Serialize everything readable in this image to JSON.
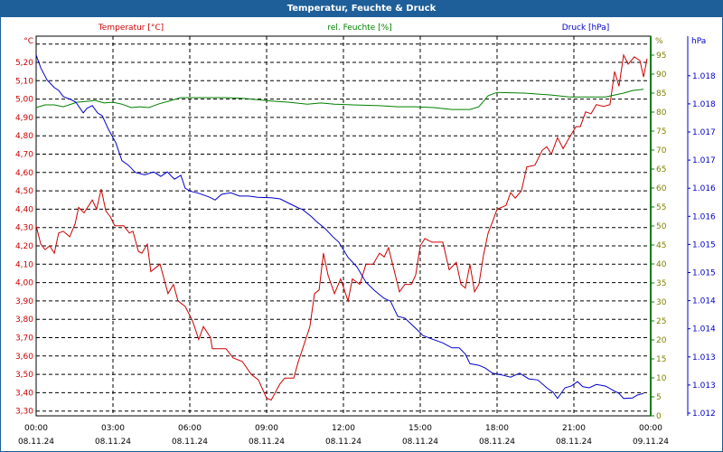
{
  "window": {
    "title": "Temperatur, Feuchte & Druck"
  },
  "colors": {
    "temperature": "#cc0000",
    "humidity": "#008000",
    "pressure": "#0000cc",
    "titlebar": "#1f5f99",
    "tick_text_humidity": "#808000"
  },
  "chart_data": {
    "type": "line",
    "title": "Temperatur, Feuchte & Druck",
    "x_unit": "hours since 08.11.24 00:00",
    "xlim": [
      0,
      24
    ],
    "x_ticks": [
      {
        "time": "00:00",
        "date": "08.11.24"
      },
      {
        "time": "03:00",
        "date": "08.11.24"
      },
      {
        "time": "06:00",
        "date": "08.11.24"
      },
      {
        "time": "09:00",
        "date": "08.11.24"
      },
      {
        "time": "12:00",
        "date": "08.11.24"
      },
      {
        "time": "15:00",
        "date": "08.11.24"
      },
      {
        "time": "18:00",
        "date": "08.11.24"
      },
      {
        "time": "21:00",
        "date": "08.11.24"
      },
      {
        "time": "00:00",
        "date": "09.11.24"
      }
    ],
    "grid": true,
    "axes": {
      "temperature": {
        "label": "Temperatur [°C]",
        "unit": "°C",
        "ylim": [
          3.274,
          5.343
        ],
        "ticks": [
          "5,20",
          "5,10",
          "5,00",
          "4,90",
          "4,80",
          "4,70",
          "4,60",
          "4,50",
          "4,40",
          "4,30",
          "4,20",
          "4,10",
          "4,00",
          "3,90",
          "3,80",
          "3,70",
          "3,60",
          "3,50",
          "3,40",
          "3,30"
        ]
      },
      "humidity": {
        "label": "rel. Feuchte [%]",
        "unit": "%",
        "ylim": [
          0,
          100
        ],
        "ticks": [
          "95",
          "90",
          "85",
          "80",
          "75",
          "70",
          "65",
          "60",
          "55",
          "50",
          "45",
          "40",
          "35",
          "30",
          "25",
          "20",
          "15",
          "10",
          "5",
          "0"
        ]
      },
      "pressure": {
        "label": "Druck [hPa]",
        "unit": "hPa",
        "ylim": [
          1.012,
          1.018
        ],
        "ticks": [
          "1.018",
          "1.018",
          "1.017",
          "1.017",
          "1.016",
          "1.016",
          "1.015",
          "1.015",
          "1.014",
          "1.014",
          "1.013",
          "1.013",
          "1.012"
        ]
      }
    },
    "series": [
      {
        "name": "Temperatur [°C]",
        "axis": "temperature",
        "points": [
          [
            0,
            4.31
          ],
          [
            0.18,
            4.21
          ],
          [
            0.35,
            4.18
          ],
          [
            0.53,
            4.2
          ],
          [
            0.71,
            4.16
          ],
          [
            0.88,
            4.27
          ],
          [
            1.06,
            4.28
          ],
          [
            1.31,
            4.25
          ],
          [
            1.52,
            4.32
          ],
          [
            1.66,
            4.41
          ],
          [
            1.87,
            4.38
          ],
          [
            2.19,
            4.45
          ],
          [
            2.36,
            4.4
          ],
          [
            2.54,
            4.51
          ],
          [
            2.72,
            4.39
          ],
          [
            2.89,
            4.36
          ],
          [
            3.07,
            4.31
          ],
          [
            3.42,
            4.31
          ],
          [
            3.64,
            4.27
          ],
          [
            3.78,
            4.28
          ],
          [
            3.99,
            4.17
          ],
          [
            4.13,
            4.16
          ],
          [
            4.34,
            4.21
          ],
          [
            4.48,
            4.06
          ],
          [
            4.84,
            4.1
          ],
          [
            5.15,
            3.94
          ],
          [
            5.36,
            3.99
          ],
          [
            5.54,
            3.9
          ],
          [
            5.82,
            3.87
          ],
          [
            6.11,
            3.79
          ],
          [
            6.35,
            3.69
          ],
          [
            6.53,
            3.76
          ],
          [
            6.81,
            3.7
          ],
          [
            6.88,
            3.64
          ],
          [
            7.41,
            3.64
          ],
          [
            7.69,
            3.59
          ],
          [
            8.05,
            3.57
          ],
          [
            8.4,
            3.5
          ],
          [
            8.68,
            3.47
          ],
          [
            9.0,
            3.37
          ],
          [
            9.18,
            3.36
          ],
          [
            9.53,
            3.45
          ],
          [
            9.71,
            3.48
          ],
          [
            10.06,
            3.48
          ],
          [
            10.24,
            3.57
          ],
          [
            10.41,
            3.64
          ],
          [
            10.69,
            3.76
          ],
          [
            10.87,
            3.94
          ],
          [
            11.05,
            3.96
          ],
          [
            11.22,
            4.16
          ],
          [
            11.4,
            4.04
          ],
          [
            11.65,
            3.94
          ],
          [
            11.89,
            4.02
          ],
          [
            12.18,
            3.9
          ],
          [
            12.35,
            4.02
          ],
          [
            12.64,
            3.99
          ],
          [
            12.88,
            4.1
          ],
          [
            13.16,
            4.1
          ],
          [
            13.41,
            4.16
          ],
          [
            13.59,
            4.14
          ],
          [
            13.76,
            4.19
          ],
          [
            14.19,
            3.95
          ],
          [
            14.4,
            3.99
          ],
          [
            14.65,
            3.99
          ],
          [
            14.82,
            4.04
          ],
          [
            15.0,
            4.2
          ],
          [
            15.18,
            4.24
          ],
          [
            15.46,
            4.22
          ],
          [
            15.64,
            4.22
          ],
          [
            15.88,
            4.22
          ],
          [
            16.13,
            4.07
          ],
          [
            16.41,
            4.11
          ],
          [
            16.59,
            3.99
          ],
          [
            16.76,
            3.97
          ],
          [
            16.94,
            4.1
          ],
          [
            17.12,
            3.95
          ],
          [
            17.29,
            3.99
          ],
          [
            17.47,
            4.15
          ],
          [
            17.65,
            4.27
          ],
          [
            17.82,
            4.33
          ],
          [
            18.0,
            4.4
          ],
          [
            18.35,
            4.42
          ],
          [
            18.53,
            4.49
          ],
          [
            18.71,
            4.46
          ],
          [
            18.95,
            4.5
          ],
          [
            19.16,
            4.63
          ],
          [
            19.48,
            4.64
          ],
          [
            19.76,
            4.72
          ],
          [
            19.94,
            4.74
          ],
          [
            20.12,
            4.7
          ],
          [
            20.36,
            4.79
          ],
          [
            20.58,
            4.73
          ],
          [
            20.82,
            4.79
          ],
          [
            21.08,
            4.85
          ],
          [
            21.25,
            4.85
          ],
          [
            21.46,
            4.93
          ],
          [
            21.67,
            4.92
          ],
          [
            21.88,
            4.97
          ],
          [
            22.16,
            4.96
          ],
          [
            22.41,
            4.97
          ],
          [
            22.59,
            5.15
          ],
          [
            22.76,
            5.07
          ],
          [
            22.94,
            5.24
          ],
          [
            23.12,
            5.19
          ],
          [
            23.36,
            5.23
          ],
          [
            23.58,
            5.21
          ],
          [
            23.72,
            5.12
          ],
          [
            23.86,
            5.22
          ]
        ]
      },
      {
        "name": "rel. Feuchte [%]",
        "axis": "humidity",
        "points": [
          [
            0,
            81.2
          ],
          [
            0.35,
            81.9
          ],
          [
            0.71,
            81.9
          ],
          [
            1.06,
            81.4
          ],
          [
            1.59,
            82.6
          ],
          [
            2.12,
            82.9
          ],
          [
            2.29,
            83.1
          ],
          [
            2.65,
            82.4
          ],
          [
            3.0,
            82.6
          ],
          [
            3.35,
            82.1
          ],
          [
            3.71,
            81.2
          ],
          [
            4.06,
            81.4
          ],
          [
            4.41,
            81.2
          ],
          [
            4.76,
            82.1
          ],
          [
            5.29,
            83.1
          ],
          [
            5.65,
            83.8
          ],
          [
            6.35,
            83.8
          ],
          [
            7.41,
            83.8
          ],
          [
            8.12,
            83.6
          ],
          [
            9.18,
            82.9
          ],
          [
            9.88,
            82.6
          ],
          [
            10.59,
            82.1
          ],
          [
            11.12,
            82.4
          ],
          [
            11.65,
            82.1
          ],
          [
            12.35,
            81.9
          ],
          [
            13.41,
            81.7
          ],
          [
            14.12,
            81.4
          ],
          [
            14.82,
            81.4
          ],
          [
            15.53,
            81.2
          ],
          [
            16.24,
            80.7
          ],
          [
            16.94,
            80.7
          ],
          [
            17.29,
            81.4
          ],
          [
            17.65,
            84.3
          ],
          [
            18.0,
            85.2
          ],
          [
            19.06,
            85.0
          ],
          [
            20.12,
            84.5
          ],
          [
            20.82,
            84.0
          ],
          [
            21.53,
            84.0
          ],
          [
            22.24,
            84.0
          ],
          [
            22.94,
            85.0
          ],
          [
            23.29,
            85.7
          ],
          [
            23.72,
            86.0
          ]
        ]
      },
      {
        "name": "Druck [hPa]",
        "axis": "pressure",
        "points": [
          [
            0,
            1.01837
          ],
          [
            0.18,
            1.01814
          ],
          [
            0.42,
            1.01793
          ],
          [
            0.71,
            1.01779
          ],
          [
            0.88,
            1.01774
          ],
          [
            1.06,
            1.01763
          ],
          [
            1.34,
            1.01758
          ],
          [
            1.55,
            1.01753
          ],
          [
            1.84,
            1.01734
          ],
          [
            1.98,
            1.01742
          ],
          [
            2.19,
            1.01747
          ],
          [
            2.4,
            1.01734
          ],
          [
            2.58,
            1.01729
          ],
          [
            2.82,
            1.01705
          ],
          [
            3.11,
            1.01681
          ],
          [
            3.35,
            1.01649
          ],
          [
            3.6,
            1.01641
          ],
          [
            3.88,
            1.01628
          ],
          [
            4.24,
            1.01624
          ],
          [
            4.59,
            1.01629
          ],
          [
            4.87,
            1.01621
          ],
          [
            5.12,
            1.01629
          ],
          [
            5.4,
            1.01616
          ],
          [
            5.65,
            1.01623
          ],
          [
            5.82,
            1.016
          ],
          [
            6.0,
            1.01595
          ],
          [
            6.35,
            1.01591
          ],
          [
            6.78,
            1.01584
          ],
          [
            6.99,
            1.01579
          ],
          [
            7.24,
            1.01589
          ],
          [
            7.59,
            1.01592
          ],
          [
            7.94,
            1.01586
          ],
          [
            8.29,
            1.01586
          ],
          [
            8.65,
            1.01584
          ],
          [
            9.18,
            1.01583
          ],
          [
            9.53,
            1.01581
          ],
          [
            9.88,
            1.01573
          ],
          [
            10.24,
            1.01565
          ],
          [
            10.41,
            1.01562
          ],
          [
            10.76,
            1.01549
          ],
          [
            10.94,
            1.01541
          ],
          [
            11.29,
            1.01528
          ],
          [
            11.58,
            1.01514
          ],
          [
            11.82,
            1.01504
          ],
          [
            12.18,
            1.01477
          ],
          [
            12.53,
            1.0146
          ],
          [
            12.88,
            1.01433
          ],
          [
            13.24,
            1.01417
          ],
          [
            13.59,
            1.01404
          ],
          [
            13.84,
            1.01399
          ],
          [
            14.12,
            1.01372
          ],
          [
            14.4,
            1.01369
          ],
          [
            14.82,
            1.01351
          ],
          [
            15.11,
            1.01338
          ],
          [
            15.39,
            1.01333
          ],
          [
            15.88,
            1.01325
          ],
          [
            16.24,
            1.01316
          ],
          [
            16.52,
            1.01316
          ],
          [
            16.76,
            1.01305
          ],
          [
            16.94,
            1.01288
          ],
          [
            17.29,
            1.01285
          ],
          [
            17.54,
            1.0128
          ],
          [
            17.82,
            1.01271
          ],
          [
            18.18,
            1.01268
          ],
          [
            18.53,
            1.01264
          ],
          [
            18.88,
            1.01271
          ],
          [
            19.24,
            1.01261
          ],
          [
            19.59,
            1.01259
          ],
          [
            19.94,
            1.01245
          ],
          [
            20.19,
            1.01237
          ],
          [
            20.36,
            1.01226
          ],
          [
            20.65,
            1.01245
          ],
          [
            20.89,
            1.01248
          ],
          [
            21.14,
            1.01256
          ],
          [
            21.35,
            1.01247
          ],
          [
            21.6,
            1.01245
          ],
          [
            21.88,
            1.01251
          ],
          [
            22.24,
            1.01248
          ],
          [
            22.59,
            1.01239
          ],
          [
            22.76,
            1.01235
          ],
          [
            22.94,
            1.01226
          ],
          [
            23.29,
            1.01227
          ],
          [
            23.47,
            1.01232
          ],
          [
            23.72,
            1.01235
          ]
        ]
      }
    ]
  }
}
